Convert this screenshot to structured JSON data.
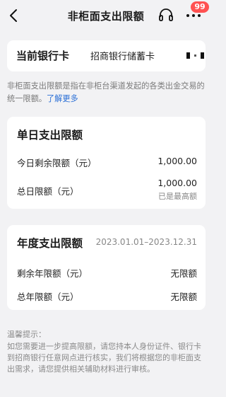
{
  "header": {
    "title": "非柜面支出限额",
    "back_icon": "back-arrow-icon",
    "support_icon": "headset-icon",
    "more_icon": "more-dots-icon",
    "badge_count": "99",
    "badge_color": "#ff5151"
  },
  "current_card": {
    "label": "当前银行卡",
    "value": "招商银行储蓄卡"
  },
  "intro": {
    "text": "非柜面支出限额是指在非柜台渠道发起的各类出金交易的统一限额。",
    "link": "了解更多",
    "link_color": "#2a6fd6"
  },
  "daily": {
    "heading": "单日支出限额",
    "remaining_label": "今日剩余限额（元）",
    "remaining_value": "1,000.00",
    "total_label": "总日限额（元）",
    "total_value": "1,000.00",
    "total_note": "已是最高额"
  },
  "yearly": {
    "heading": "年度支出限额",
    "period": "2023.01.01–2023.12.31",
    "remaining_label": "剩余年限额（元）",
    "remaining_value": "无限额",
    "total_label": "总年限额（元）",
    "total_value": "无限额"
  },
  "tips": {
    "title": "温馨提示：",
    "text": "如您需要进一步提高限额，请您持本人身份证件、银行卡到招商银行任意网点进行核实，我们将根据您的非柜面支出需求，请您提供相关辅助材料进行审核。"
  }
}
